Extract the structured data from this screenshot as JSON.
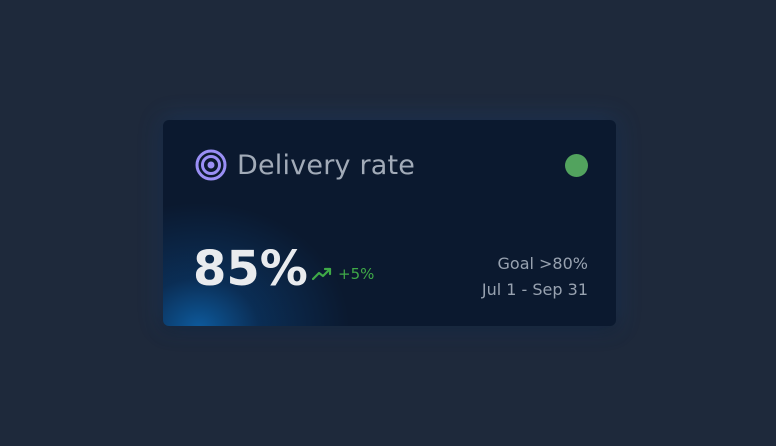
{
  "card": {
    "title": "Delivery rate",
    "icon": "target-icon",
    "status_color": "#52a35e",
    "value": "85%",
    "trend": {
      "icon": "trending-up-icon",
      "value": "+5%",
      "color": "#3faa47"
    },
    "goal": "Goal >80%",
    "date_range": "Jul 1 - Sep 31"
  },
  "colors": {
    "page_background": "#1e293b",
    "card_background": "#0b192f",
    "icon_accent": "#9a8ff5"
  }
}
